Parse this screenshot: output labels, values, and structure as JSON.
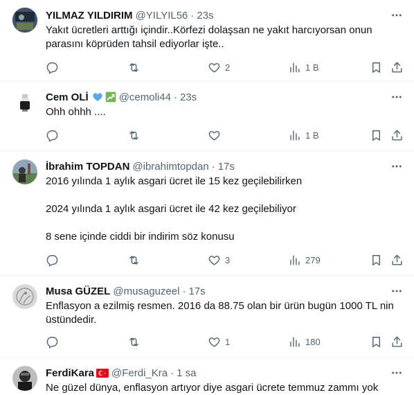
{
  "tweets": [
    {
      "name": "YILMAZ YILDIRIM",
      "handle": "@YILYIL56",
      "sep": "·",
      "time": "23s",
      "lines": [
        "Yakıt ücretleri arttığı içindir..Körfezi dolaşsan ne yakıt harcıyorsan onun",
        "parasını köprüden tahsil ediyorlar işte.."
      ],
      "likes": "2",
      "views": "1 B"
    },
    {
      "name": "Cem OLİ",
      "handle": "@cemoli44",
      "sep": "·",
      "time": "23s",
      "lines": [
        "Ohh ohhh ...."
      ],
      "likes": "",
      "views": "1 B"
    },
    {
      "name": "İbrahim TOPDAN",
      "handle": "@ibrahimtopdan",
      "sep": "·",
      "time": "17s",
      "lines": [
        "2016 yılında 1 aylık asgari ücret ile 15 kez geçilebilirken",
        "",
        "2024 yılında 1 aylık asgari ücret ile 42 kez geçilebiliyor",
        "",
        "8 sene içinde ciddi bir indirim söz konusu"
      ],
      "likes": "3",
      "views": "279"
    },
    {
      "name": "Musa GÜZEL",
      "handle": "@musaguzeel",
      "sep": "·",
      "time": "17s",
      "lines": [
        "Enflasyon a ezilmiş resmen. 2016 da 88.75 olan bir ürün bugün 1000 TL nin",
        "üstündedir."
      ],
      "likes": "1",
      "views": "180"
    },
    {
      "name": "FerdiKara",
      "handle": "@Ferdi_Kra",
      "sep": "·",
      "time": "1 sa",
      "lines": [
        "Ne güzel dünya, enflasyon artıyor diye asgari ücrete temmuz zammı yok"
      ],
      "likes": "",
      "views": ""
    }
  ],
  "icons": {
    "reply": "reply-icon",
    "retweet": "retweet-icon",
    "like": "heart-icon",
    "views": "views-icon",
    "bookmark": "bookmark-icon",
    "share": "share-icon",
    "more": "more-icon"
  },
  "colors": {
    "text": "#0f1419",
    "secondary": "#536471",
    "border": "#eff3f4",
    "blue_heart": "#5aa9e6",
    "green_badge": "#78b159",
    "flag_red": "#e30a17"
  }
}
